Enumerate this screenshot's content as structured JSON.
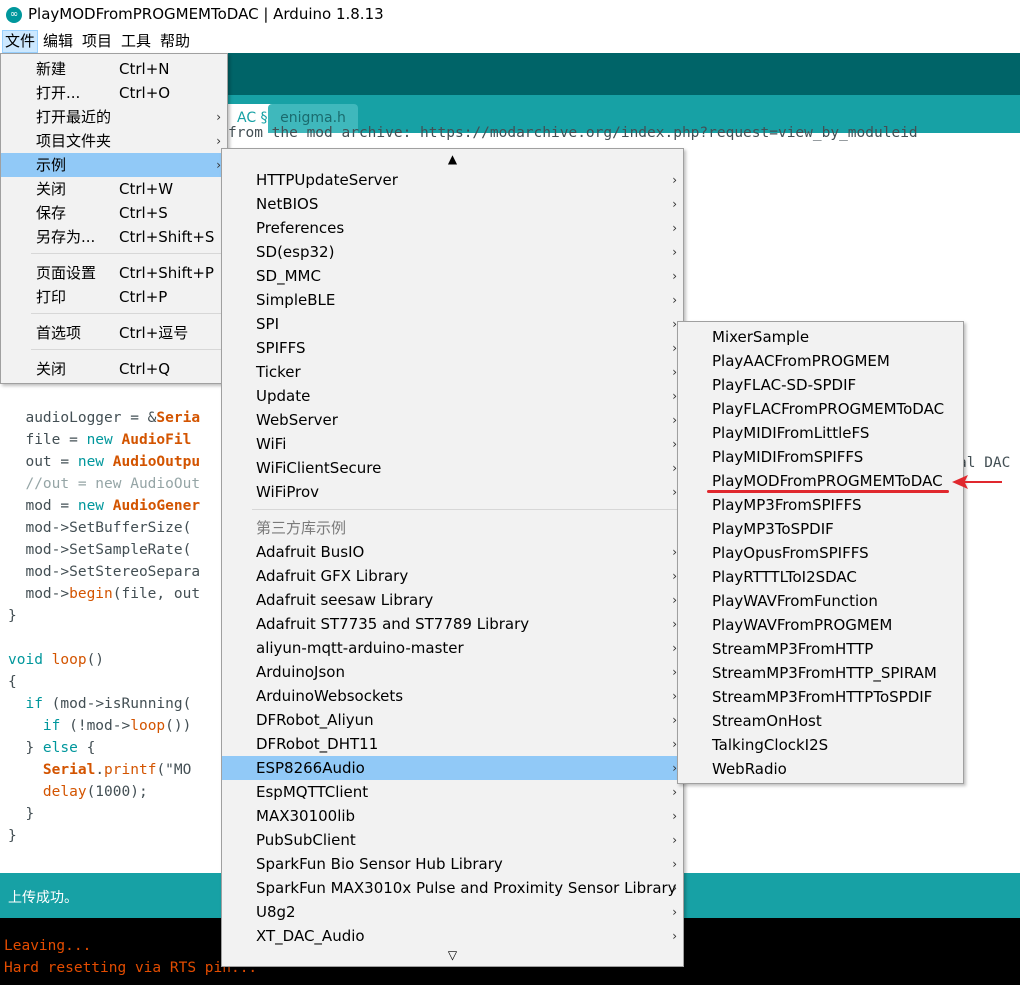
{
  "window": {
    "title": "PlayMODFromPROGMEMToDAC | Arduino 1.8.13"
  },
  "menubar": {
    "items": [
      "文件",
      "编辑",
      "项目",
      "工具",
      "帮助"
    ]
  },
  "tabs": {
    "main_label": "AC §",
    "second_label": "enigma.h"
  },
  "file_menu": {
    "items": [
      {
        "label": "新建",
        "shortcut": "Ctrl+N"
      },
      {
        "label": "打开...",
        "shortcut": "Ctrl+O"
      },
      {
        "label": "打开最近的",
        "shortcut": ""
      },
      {
        "label": "项目文件夹",
        "shortcut": ""
      },
      {
        "label": "示例",
        "shortcut": ""
      },
      {
        "label": "关闭",
        "shortcut": "Ctrl+W"
      },
      {
        "label": "保存",
        "shortcut": "Ctrl+S"
      },
      {
        "label": "另存为...",
        "shortcut": "Ctrl+Shift+S"
      },
      {
        "label": "页面设置",
        "shortcut": "Ctrl+Shift+P"
      },
      {
        "label": "打印",
        "shortcut": "Ctrl+P"
      },
      {
        "label": "首选项",
        "shortcut": "Ctrl+逗号"
      },
      {
        "label": "关闭",
        "shortcut": "Ctrl+Q"
      }
    ]
  },
  "examples_menu": {
    "scroll_up": "▲",
    "scroll_down": "▽",
    "items": [
      "HTTPUpdateServer",
      "NetBIOS",
      "Preferences",
      "SD(esp32)",
      "SD_MMC",
      "SimpleBLE",
      "SPI",
      "SPIFFS",
      "Ticker",
      "Update",
      "WebServer",
      "WiFi",
      "WiFiClientSecure",
      "WiFiProv"
    ],
    "third_party_header": "第三方库示例",
    "third_party_items": [
      "Adafruit BusIO",
      "Adafruit GFX Library",
      "Adafruit seesaw Library",
      "Adafruit ST7735 and ST7789 Library",
      "aliyun-mqtt-arduino-master",
      "ArduinoJson",
      "ArduinoWebsockets",
      "DFRobot_Aliyun",
      "DFRobot_DHT11",
      "ESP8266Audio",
      "EspMQTTClient",
      "MAX30100lib",
      "PubSubClient",
      "SparkFun Bio Sensor Hub Library",
      "SparkFun MAX3010x Pulse and Proximity Sensor Library",
      "U8g2",
      "XT_DAC_Audio"
    ]
  },
  "esp8266audio_menu": {
    "items": [
      "MixerSample",
      "PlayAACFromPROGMEM",
      "PlayFLAC-SD-SPDIF",
      "PlayFLACFromPROGMEMToDAC",
      "PlayMIDIFromLittleFS",
      "PlayMIDIFromSPIFFS",
      "PlayMODFromPROGMEMToDAC",
      "PlayMP3FromSPIFFS",
      "PlayMP3ToSPDIF",
      "PlayOpusFromSPIFFS",
      "PlayRTTTLToI2SDAC",
      "PlayWAVFromFunction",
      "PlayWAVFromPROGMEM",
      "StreamMP3FromHTTP",
      "StreamMP3FromHTTP_SPIRAM",
      "StreamMP3FromHTTPToSPDIF",
      "StreamOnHost",
      "TalkingClockI2S",
      "WebRadio"
    ]
  },
  "editor": {
    "url_fragment": "from the mod archive: https://modarchive.org/index.php?request=view_by_moduleid",
    "side_fragment": "al DAC",
    "lines": {
      "l1_a": "  audioLogger = &",
      "l1_b": "Seria",
      "l2_a": "  file = ",
      "l2_kw": "new",
      "l2_b": " AudioFil",
      "l3_a": "  out = ",
      "l3_kw": "new",
      "l3_b": " AudioOutpu",
      "l4": "  //out = new AudioOut",
      "l5_a": "  mod = ",
      "l5_kw": "new",
      "l5_b": " AudioGener",
      "l6": "  mod->SetBufferSize(",
      "l7": "  mod->SetSampleRate(",
      "l8": "  mod->SetStereoSepara",
      "l9_a": "  mod->",
      "l9_fn": "begin",
      "l9_b": "(file, out",
      "l10": "}",
      "l11_kw": "void",
      "l11_b": " ",
      "l11_fn": "loop",
      "l11_c": "()",
      "l12": "{",
      "l13_a": "  ",
      "l13_kw": "if",
      "l13_b": " (mod->isRunning(",
      "l14_a": "    ",
      "l14_kw": "if",
      "l14_b": " (!mod->",
      "l14_fn": "loop",
      "l14_c": "())",
      "l15_a": "  } ",
      "l15_kw": "else",
      "l15_b": " {",
      "l16_a": "    ",
      "l16_ty": "Serial",
      "l16_b": ".",
      "l16_fn": "printf",
      "l16_c": "(\"MO",
      "l17_a": "    ",
      "l17_fn": "delay",
      "l17_b": "(1000);",
      "l18": "  }",
      "l19": "}"
    }
  },
  "status": {
    "text": "上传成功。"
  },
  "console": {
    "line1": "Leaving...",
    "line2": "Hard resetting via RTS pin..."
  },
  "colors": {
    "teal_dark": "#006468",
    "teal": "#17a1a5",
    "menu_highlight": "#91c9f7",
    "annotation_red": "#e0282e"
  }
}
